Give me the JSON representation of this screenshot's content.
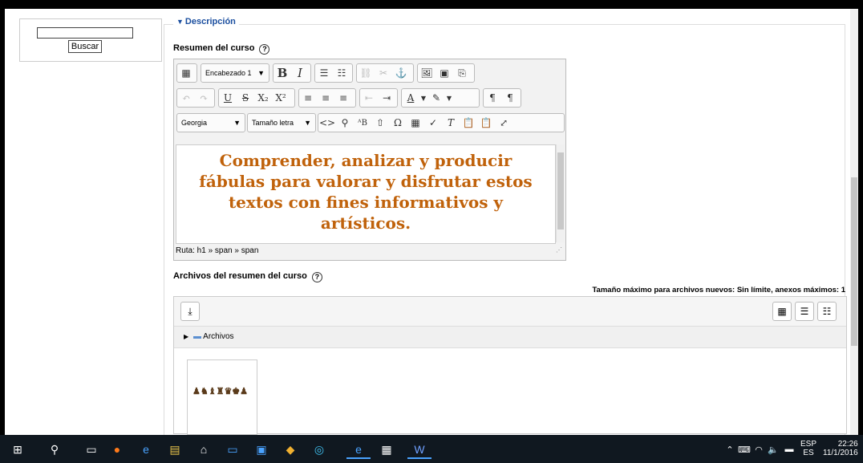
{
  "search": {
    "button_label": "Buscar",
    "value": ""
  },
  "section": {
    "legend": "Descripción"
  },
  "summary": {
    "label": "Resumen del curso",
    "help_icon": "question-circle-icon",
    "toolbar": {
      "heading_select": "Encabezado 1",
      "font_select": "Georgia",
      "size_select": "Tamaño letra"
    },
    "content_lines": [
      "Comprender, analizar y producir",
      "fábulas para valorar y disfrutar estos",
      "textos con fines informativos y",
      "artísticos."
    ],
    "content_color": "#c0620b",
    "status_path": "Ruta: h1 » span » span"
  },
  "files": {
    "label": "Archivos del resumen del curso",
    "limits": "Tamaño máximo para archivos nuevos: Sin límite, anexos máximos: 1",
    "folder_label": "Archivos"
  },
  "taskbar": {
    "lang_top": "ESP",
    "lang_bottom": "ES",
    "time": "22:26",
    "date": "11/1/2016"
  }
}
